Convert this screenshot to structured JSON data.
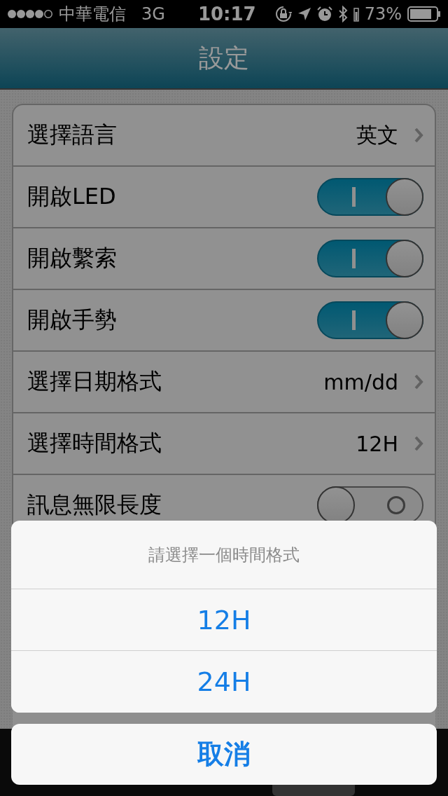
{
  "status_bar": {
    "carrier": "中華電信",
    "network": "3G",
    "time": "10:17",
    "battery": "73%"
  },
  "nav_bar": {
    "title": "設定"
  },
  "settings": [
    {
      "kind": "value",
      "label": "選擇語言",
      "value": "英文"
    },
    {
      "kind": "toggle",
      "label": "開啟LED",
      "on": true
    },
    {
      "kind": "toggle",
      "label": "開啟繫索",
      "on": true
    },
    {
      "kind": "toggle",
      "label": "開啟手勢",
      "on": true
    },
    {
      "kind": "value",
      "label": "選擇日期格式",
      "value": "mm/dd"
    },
    {
      "kind": "value",
      "label": "選擇時間格式",
      "value": "12H"
    },
    {
      "kind": "toggle",
      "label": "訊息無限長度",
      "on": false
    }
  ],
  "tab_bar": [
    {
      "selected": false
    },
    {
      "selected": false
    },
    {
      "selected": false
    },
    {
      "selected": true
    },
    {
      "selected": false
    }
  ],
  "action_sheet": {
    "title": "請選擇一個時間格式",
    "options": [
      "12H",
      "24H"
    ],
    "cancel": "取消"
  }
}
